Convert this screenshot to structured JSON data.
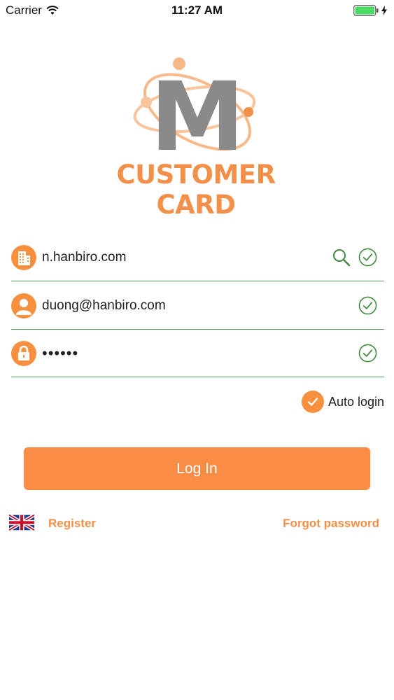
{
  "status_bar": {
    "carrier": "Carrier",
    "time": "11:27 AM",
    "battery_color": "#4cd964"
  },
  "logo": {
    "letter": "M",
    "text": "CUSTOMER CARD"
  },
  "form": {
    "domain": {
      "value": "n.hanbiro.com",
      "icon": "building-icon",
      "search_icon": "search-icon",
      "check_icon": "check-circle-icon"
    },
    "email": {
      "value": "duong@hanbiro.com",
      "icon": "user-icon",
      "check_icon": "check-circle-icon"
    },
    "password": {
      "value": "••••••",
      "icon": "lock-icon",
      "check_icon": "check-circle-icon"
    }
  },
  "auto_login": {
    "label": "Auto login",
    "checked": true
  },
  "login_button": {
    "label": "Log In"
  },
  "footer": {
    "language_icon": "uk-flag-icon",
    "register": "Register",
    "forgot_password": "Forgot password"
  },
  "colors": {
    "accent": "#f6903e",
    "divider": "#5a9c5a",
    "check": "#3d8a3d"
  }
}
